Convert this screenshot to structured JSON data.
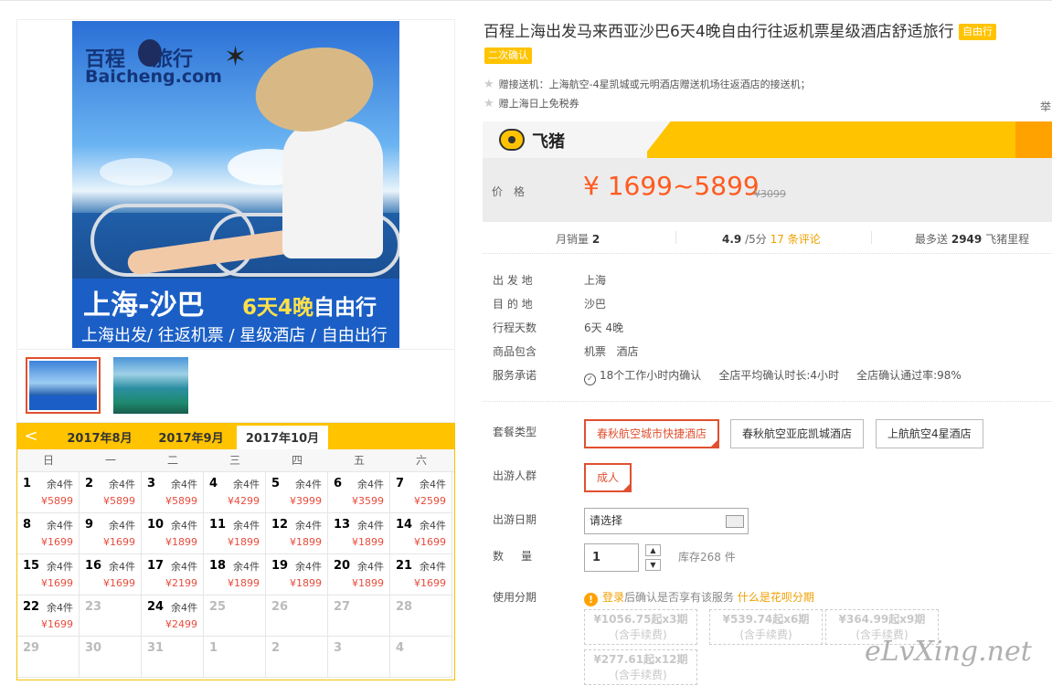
{
  "hero": {
    "logo_cn": "百程",
    "logo_cn2": "旅行",
    "logo_en": "Baicheng.com",
    "banner_title": "上海-沙巴",
    "banner_days": "6天4晚",
    "banner_days_tail": "自由行",
    "banner_sub": "上海出发/ 往返机票 / 星级酒店 / 自由出行"
  },
  "calendar": {
    "prev_label": "<",
    "months": [
      "2017年8月",
      "2017年9月",
      "2017年10月"
    ],
    "active_month": 2,
    "weekdays": [
      "日",
      "一",
      "二",
      "三",
      "四",
      "五",
      "六"
    ],
    "rows": [
      [
        {
          "d": "1",
          "s": "余4件",
          "p": "¥5899"
        },
        {
          "d": "2",
          "s": "余4件",
          "p": "¥5899"
        },
        {
          "d": "3",
          "s": "余4件",
          "p": "¥5899"
        },
        {
          "d": "4",
          "s": "余4件",
          "p": "¥4299"
        },
        {
          "d": "5",
          "s": "余4件",
          "p": "¥3999"
        },
        {
          "d": "6",
          "s": "余4件",
          "p": "¥3599"
        },
        {
          "d": "7",
          "s": "余4件",
          "p": "¥2599"
        }
      ],
      [
        {
          "d": "8",
          "s": "余4件",
          "p": "¥1699"
        },
        {
          "d": "9",
          "s": "余4件",
          "p": "¥1699"
        },
        {
          "d": "10",
          "s": "余4件",
          "p": "¥1899"
        },
        {
          "d": "11",
          "s": "余4件",
          "p": "¥1899"
        },
        {
          "d": "12",
          "s": "余4件",
          "p": "¥1899"
        },
        {
          "d": "13",
          "s": "余4件",
          "p": "¥1899"
        },
        {
          "d": "14",
          "s": "余4件",
          "p": "¥1699"
        }
      ],
      [
        {
          "d": "15",
          "s": "余4件",
          "p": "¥1699"
        },
        {
          "d": "16",
          "s": "余4件",
          "p": "¥1699"
        },
        {
          "d": "17",
          "s": "余4件",
          "p": "¥2199"
        },
        {
          "d": "18",
          "s": "余4件",
          "p": "¥1899"
        },
        {
          "d": "19",
          "s": "余4件",
          "p": "¥1899"
        },
        {
          "d": "20",
          "s": "余4件",
          "p": "¥1899"
        },
        {
          "d": "21",
          "s": "余4件",
          "p": "¥1699"
        }
      ],
      [
        {
          "d": "22",
          "s": "余4件",
          "p": "¥1699"
        },
        {
          "d": "23",
          "s": "",
          "p": "",
          "dis": true
        },
        {
          "d": "24",
          "s": "余4件",
          "p": "¥2499"
        },
        {
          "d": "25",
          "s": "",
          "p": "",
          "dis": true
        },
        {
          "d": "26",
          "s": "",
          "p": "",
          "dis": true
        },
        {
          "d": "27",
          "s": "",
          "p": "",
          "dis": true
        },
        {
          "d": "28",
          "s": "",
          "p": "",
          "dis": true
        }
      ],
      [
        {
          "d": "29",
          "s": "",
          "p": "",
          "dis": true
        },
        {
          "d": "30",
          "s": "",
          "p": "",
          "dis": true
        },
        {
          "d": "31",
          "s": "",
          "p": "",
          "dis": true
        },
        {
          "d": "1",
          "s": "",
          "p": "",
          "dis": true
        },
        {
          "d": "2",
          "s": "",
          "p": "",
          "dis": true
        },
        {
          "d": "3",
          "s": "",
          "p": "",
          "dis": true
        },
        {
          "d": "4",
          "s": "",
          "p": "",
          "dis": true
        }
      ]
    ]
  },
  "product": {
    "title": "百程上海出发马来西亚沙巴6天4晚自由行往返机票星级酒店舒适旅行",
    "tag_free": "自由行",
    "tag_confirm": "二次确认",
    "gift1": "赠接送机：上海航空-4星凯城或元明酒店赠送机场往返酒店的接送机；",
    "gift2": "赠上海日上免税券",
    "report": "举",
    "brand": "飞猪",
    "price_label": "价格",
    "price": "¥ 1699~5899",
    "old_price": "¥3099",
    "monthly_sales_label": "月销量",
    "monthly_sales": "2",
    "rating": "4.9",
    "rating_suffix": "/5分",
    "reviews": "17 条评论",
    "miles_prefix": "最多送",
    "miles": "2949",
    "miles_suffix": "飞猪里程"
  },
  "info": [
    {
      "k": "出 发 地",
      "v": "上海"
    },
    {
      "k": "目 的 地",
      "v": "沙巴"
    },
    {
      "k": "行程天数",
      "v": "6天 4晚"
    },
    {
      "k": "商品包含",
      "v": "机票   酒店"
    },
    {
      "k": "服务承诺",
      "v": "18个工作小时内确认     全店平均确认时长:4小时     全店确认通过率:98%"
    }
  ],
  "options": {
    "package_label": "套餐类型",
    "packages": [
      "春秋航空城市快捷酒店",
      "春秋航空亚庇凯城酒店",
      "上航航空4星酒店"
    ],
    "crowd_label": "出游人群",
    "crowd": "成人",
    "date_label": "出游日期",
    "date_placeholder": "请选择",
    "qty_label": "数     量",
    "qty_value": "1",
    "stock": "库存268 件",
    "installment_label": "使用分期",
    "login_text": "登录",
    "login_tail": "后确认是否享有该服务",
    "huabei_link": "什么是花呗分期",
    "plans": [
      {
        "amt": "¥1056.75起x3期",
        "fee": "(含手续费)"
      },
      {
        "amt": "¥539.74起x6期",
        "fee": "(含手续费)"
      },
      {
        "amt": "¥364.99起x9期",
        "fee": "(含手续费)"
      },
      {
        "amt": "¥277.61起x12期",
        "fee": "(含手续费)"
      }
    ]
  },
  "watermark": "eLvXing.net"
}
